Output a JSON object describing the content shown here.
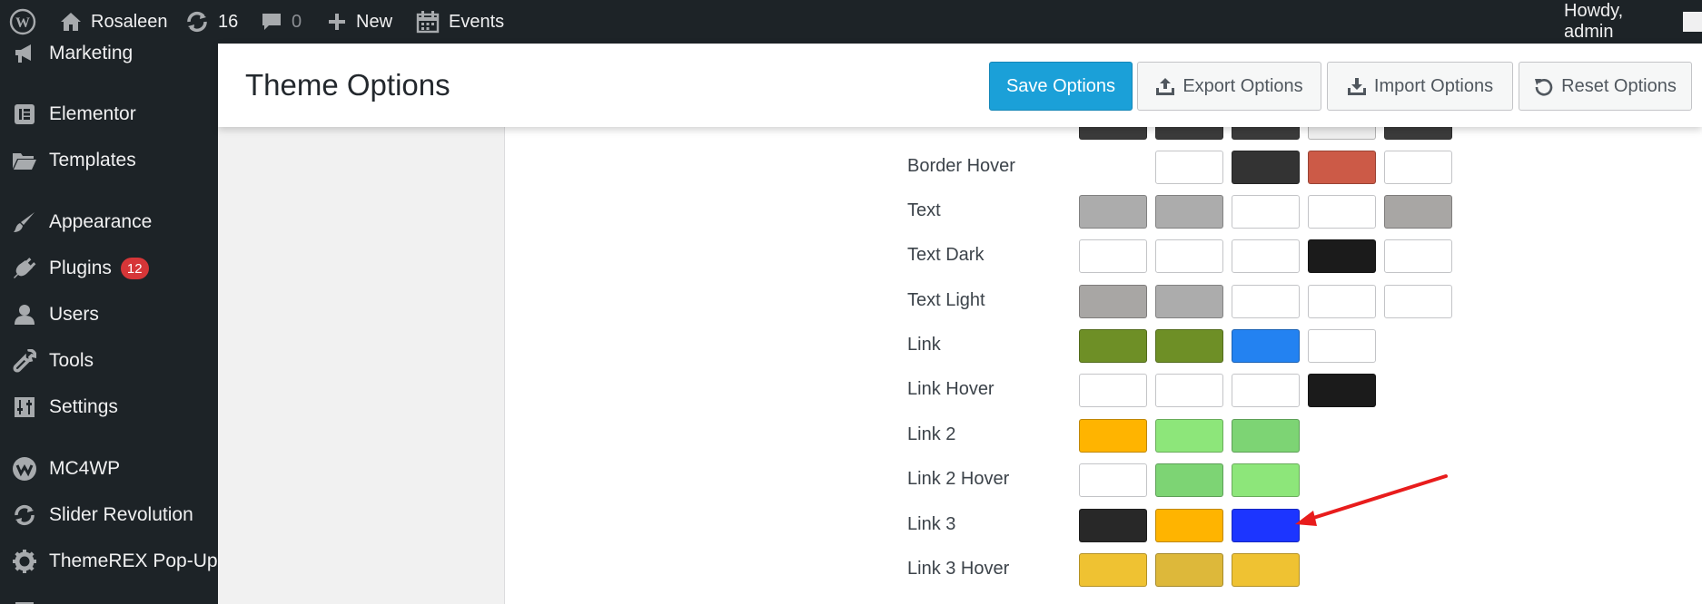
{
  "adminbar": {
    "site_name": "Rosaleen",
    "updates_count": "16",
    "comments_count": "0",
    "new_label": "New",
    "events_label": "Events",
    "howdy": "Howdy, admin"
  },
  "sidebar": {
    "items": [
      {
        "label": "Marketing",
        "icon": "megaphone-icon"
      },
      {
        "label": "Elementor",
        "icon": "elementor-icon"
      },
      {
        "label": "Templates",
        "icon": "folder-icon"
      },
      {
        "label": "Appearance",
        "icon": "brush-icon"
      },
      {
        "label": "Plugins",
        "icon": "plug-icon",
        "badge": "12"
      },
      {
        "label": "Users",
        "icon": "user-icon"
      },
      {
        "label": "Tools",
        "icon": "wrench-icon"
      },
      {
        "label": "Settings",
        "icon": "settings-sliders-icon"
      },
      {
        "label": "MC4WP",
        "icon": "mc4wp-icon"
      },
      {
        "label": "Slider Revolution",
        "icon": "refresh-icon"
      },
      {
        "label": "ThemeREX Pop-Up",
        "icon": "gear-icon"
      }
    ]
  },
  "header": {
    "title": "Theme Options",
    "save_label": "Save Options",
    "export_label": "Export Options",
    "import_label": "Import Options",
    "reset_label": "Reset Options"
  },
  "color_rows": [
    {
      "label": "",
      "colors": [
        "#3b3b3b",
        "#3b3b3b",
        "#3b3b3b",
        "#eeeeee",
        "#3b3b3b"
      ]
    },
    {
      "label": "Border Hover",
      "colors": [
        null,
        "#ffffff",
        "#333333",
        "#cc5a47",
        "#ffffff"
      ]
    },
    {
      "label": "Text",
      "colors": [
        "#acacac",
        "#acacac",
        "#ffffff",
        "#ffffff",
        "#a8a6a4"
      ]
    },
    {
      "label": "Text Dark",
      "colors": [
        "#ffffff",
        "#ffffff",
        "#ffffff",
        "#1b1b1b",
        "#ffffff"
      ]
    },
    {
      "label": "Text Light",
      "colors": [
        "#a8a6a4",
        "#acacac",
        "#ffffff",
        "#ffffff",
        "#ffffff"
      ]
    },
    {
      "label": "Link",
      "colors": [
        "#6e8f26",
        "#6e8f26",
        "#2382f1",
        "#ffffff"
      ]
    },
    {
      "label": "Link Hover",
      "colors": [
        "#ffffff",
        "#ffffff",
        "#ffffff",
        "#1b1b1b"
      ]
    },
    {
      "label": "Link 2",
      "colors": [
        "#ffb400",
        "#8de67a",
        "#7dd474"
      ]
    },
    {
      "label": "Link 2 Hover",
      "colors": [
        "#ffffff",
        "#7dd474",
        "#8de67a"
      ]
    },
    {
      "label": "Link 3",
      "colors": [
        "#282828",
        "#ffb400",
        "#1c35ff"
      ]
    },
    {
      "label": "Link 3 Hover",
      "colors": [
        "#efc232",
        "#ddb83a",
        "#efc232"
      ]
    }
  ],
  "accent_colors": {
    "adminbar": "#1d2327",
    "primary_button": "#1ba0d8",
    "annotation_arrow": "#e81c1c"
  }
}
